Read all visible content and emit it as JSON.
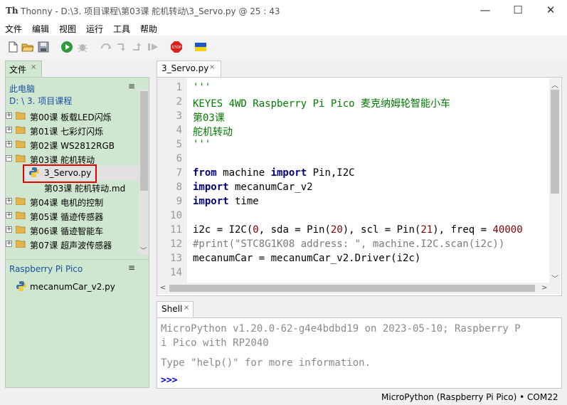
{
  "window": {
    "app_icon": "Th",
    "title": "Thonny  -  D:\\3. 项目课程\\第03课 舵机转动\\3_Servo.py  @  25 : 43",
    "minimize": "—",
    "maximize": "☐",
    "close": "✕"
  },
  "menu": [
    "文件",
    "编辑",
    "视图",
    "运行",
    "工具",
    "帮助"
  ],
  "toolbar_icons": [
    "new-file-icon",
    "open-folder-icon",
    "save-icon",
    "run-icon",
    "debug-icon",
    "step-over-icon",
    "step-into-icon",
    "step-out-icon",
    "resume-icon",
    "stop-icon",
    "ukraine-flag-icon"
  ],
  "stop_label": "STOP",
  "files_panel": {
    "tab": "文件",
    "close": "×",
    "location_line1": "此电脑",
    "location_line2": "D: \\ 3. 项目课程",
    "menu_glyph": "≡",
    "tree": [
      {
        "expander": "+",
        "label": "第00课 板载LED闪烁"
      },
      {
        "expander": "+",
        "label": "第01课 七彩灯闪烁"
      },
      {
        "expander": "+",
        "label": "第02课 WS2812RGB"
      },
      {
        "expander": "−",
        "label": "第03课 舵机转动"
      },
      {
        "expander": "",
        "label": "3_Servo.py"
      },
      {
        "expander": "",
        "label": "第03课 舵机转动.md"
      },
      {
        "expander": "+",
        "label": "第04课 电机的控制"
      },
      {
        "expander": "+",
        "label": "第05课 循迹传感器"
      },
      {
        "expander": "+",
        "label": "第06课 循迹智能车"
      },
      {
        "expander": "+",
        "label": "第07课 超声波传感器"
      }
    ],
    "pico_header": "Raspberry Pi Pico",
    "pico_files": [
      "mecanumCar_v2.py"
    ]
  },
  "editor": {
    "tab": "3_Servo.py",
    "close": "×",
    "line_numbers": [
      "1",
      "2",
      "3",
      "4",
      "5",
      "6",
      "7",
      "8",
      "9",
      "10",
      "11",
      "12",
      "13",
      "14"
    ],
    "lines": {
      "l1": "'''",
      "l2": "KEYES 4WD Raspberry Pi Pico 麦克纳姆轮智能小车",
      "l3": "第03课",
      "l4": "舵机转动",
      "l5": "'''",
      "l7_kw1": "from",
      "l7_a": " machine ",
      "l7_kw2": "import",
      "l7_b": " Pin,I2C",
      "l8_kw": "import",
      "l8_b": " mecanumCar_v2",
      "l9_kw": "import",
      "l9_b": " time",
      "l11_a": "i2c = I2C(",
      "l11_n1": "0",
      "l11_b": ", sda = Pin(",
      "l11_n2": "20",
      "l11_c": "), scl = Pin(",
      "l11_n3": "21",
      "l11_d": "), freq = ",
      "l11_n4": "40000",
      "l12": "#print(\"STC8G1K08 address: \", machine.I2C.scan(i2c))",
      "l13": "mecanumCar = mecanumCar_v2.Driver(i2c)"
    }
  },
  "shell": {
    "tab": "Shell",
    "close": "×",
    "line1": "MicroPython v1.20.0-62-g4e4bdbd19 on 2023-05-10; Raspberry P",
    "line2": "i Pico with RP2040",
    "line3": "Type \"help()\" for more information.",
    "prompt": ">>>"
  },
  "status": "MicroPython (Raspberry Pi Pico)  •  COM22"
}
